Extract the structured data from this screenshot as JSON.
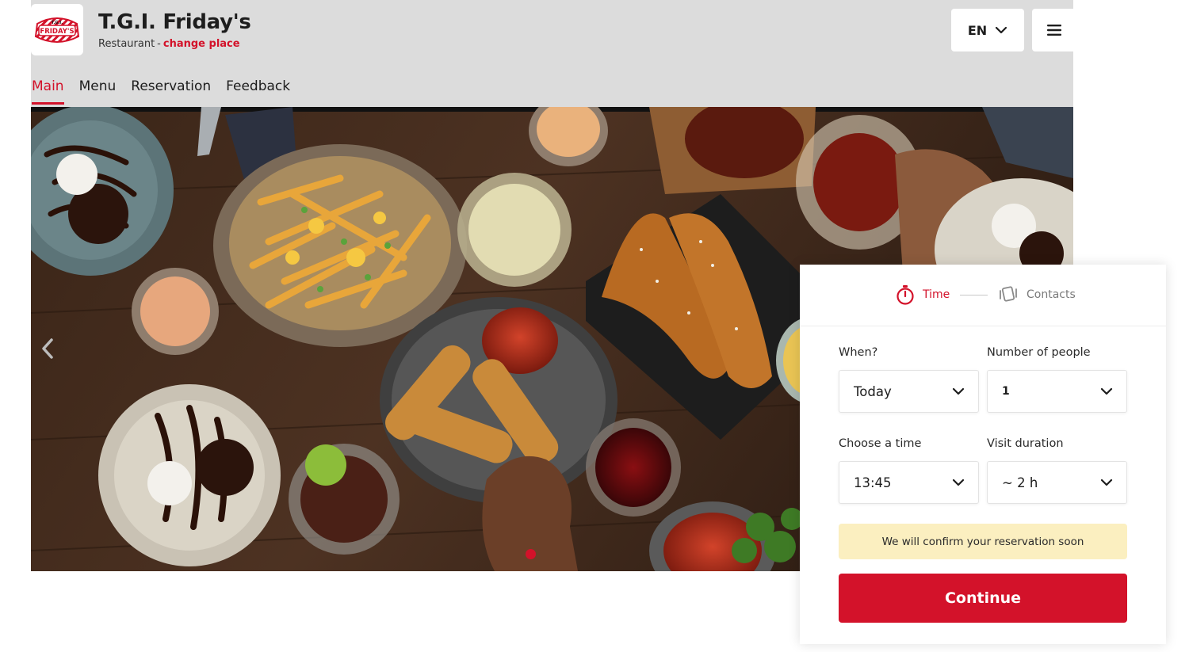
{
  "header": {
    "logo_text": "T.G.I. FRIDAY'S",
    "brand_name": "T.G.I. Friday's",
    "brand_type": "Restaurant",
    "separator": "-",
    "change_place": "change place",
    "language": "EN"
  },
  "nav": {
    "items": [
      {
        "label": "Main",
        "active": true
      },
      {
        "label": "Menu",
        "active": false
      },
      {
        "label": "Reservation",
        "active": false
      },
      {
        "label": "Feedback",
        "active": false
      }
    ]
  },
  "hero": {
    "image": "food-spread-photo",
    "slides_current": 1
  },
  "booking": {
    "steps": [
      {
        "label": "Time",
        "icon": "stopwatch-icon",
        "active": true
      },
      {
        "label": "Contacts",
        "icon": "contacts-icon",
        "active": false
      }
    ],
    "when": {
      "label": "When?",
      "value": "Today"
    },
    "people": {
      "label": "Number of people",
      "value": "1"
    },
    "time": {
      "label": "Choose a time",
      "value": "13:45"
    },
    "duration": {
      "label": "Visit duration",
      "value": "~ 2 h"
    },
    "notice": "We will confirm your reservation soon",
    "continue_label": "Continue"
  },
  "colors": {
    "accent": "#d3122a",
    "header_bg": "#dcdcdc",
    "notice_bg": "#fbefc0"
  }
}
